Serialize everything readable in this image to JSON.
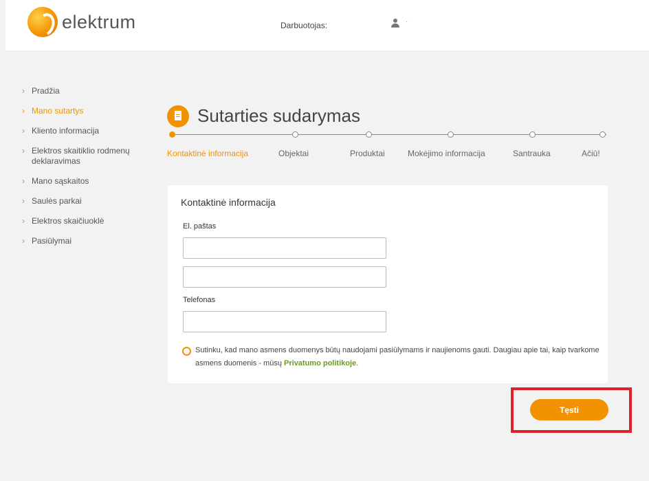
{
  "header": {
    "logo_text": "elektrum",
    "employee_label": "Darbuotojas:",
    "user_value": "·"
  },
  "sidebar": {
    "items": [
      {
        "label": "Pradžia",
        "active": false
      },
      {
        "label": "Mano sutartys",
        "active": true
      },
      {
        "label": "Kliento informacija",
        "active": false
      },
      {
        "label": "Elektros skaitiklio rodmenų deklaravimas",
        "active": false
      },
      {
        "label": "Mano sąskaitos",
        "active": false
      },
      {
        "label": "Saulės parkai",
        "active": false
      },
      {
        "label": "Elektros skaičiuoklė",
        "active": false
      },
      {
        "label": "Pasiūlymai",
        "active": false
      }
    ]
  },
  "main": {
    "title": "Sutarties sudarymas",
    "steps": [
      {
        "label": "Kontaktinė informacija",
        "active": true
      },
      {
        "label": "Objektai",
        "active": false
      },
      {
        "label": "Produktai",
        "active": false
      },
      {
        "label": "Mokėjimo informacija",
        "active": false
      },
      {
        "label": "Santrauka",
        "active": false
      },
      {
        "label": "Ačiū!",
        "active": false
      }
    ],
    "form": {
      "title": "Kontaktinė informacija",
      "email_label": "El. paštas",
      "email_value": "",
      "email_confirm_value": "",
      "phone_label": "Telefonas",
      "phone_value": "",
      "consent_text": "Sutinku, kad mano asmens duomenys būtų naudojami pasiūlymams ir naujienoms gauti. Daugiau apie tai, kaip tvarkome asmens duomenis - mūsų",
      "privacy_link": "Privatumo politikoje",
      "consent_end": "."
    },
    "continue_label": "Tęsti"
  },
  "colors": {
    "accent": "#f39200",
    "link": "#6a9a1f",
    "highlight": "#e0202a"
  }
}
